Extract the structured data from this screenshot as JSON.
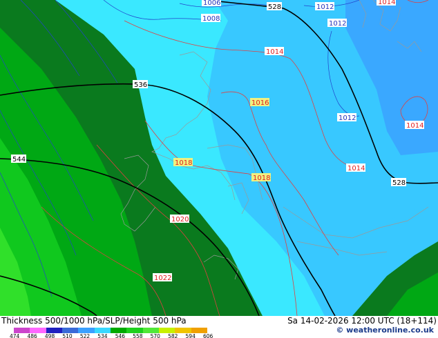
{
  "footer": {
    "title": "Thickness 500/1000 hPa/SLP/Height 500 hPa",
    "date": "Sa 14-02-2026 12:00 UTC (18+114)",
    "copyright": "© weatheronline.co.uk",
    "legend_ticks": [
      "474",
      "486",
      "498",
      "510",
      "522",
      "534",
      "546",
      "558",
      "570",
      "582",
      "594",
      "606"
    ],
    "legend_colors": [
      "#cc44cc",
      "#ff66ff",
      "#2020c0",
      "#3a6ad8",
      "#3aa0ff",
      "#38d8ff",
      "#00aa00",
      "#1ed01e",
      "#50e838",
      "#c8f000",
      "#f0c400",
      "#f0a000"
    ]
  },
  "map": {
    "thickness_labels": [
      "536",
      "544",
      "528",
      "528"
    ],
    "isobar_labels_red": [
      "1014",
      "1014",
      "1016",
      "1018",
      "1018",
      "1014",
      "1014",
      "1020",
      "1022",
      "1014"
    ],
    "isobar_labels_blue": [
      "1006",
      "1008",
      "1012",
      "1012",
      "1012"
    ]
  }
}
